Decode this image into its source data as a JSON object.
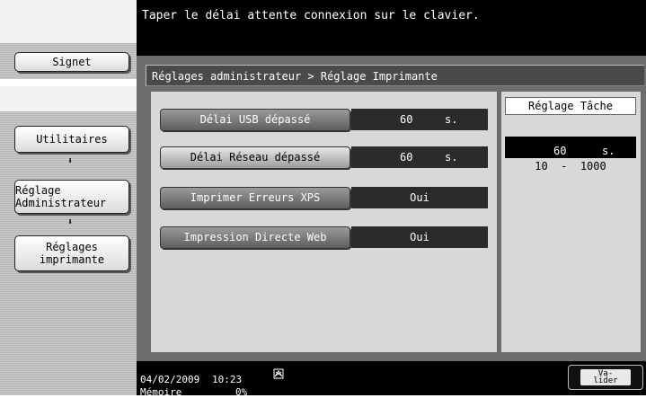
{
  "message": "Taper le délai attente connexion sur le clavier.",
  "sidebar": {
    "bookmark_label": "Signet",
    "utilities_label": "Utilitaires",
    "admin_label": "Réglage\nAdministrateur",
    "printer_label": "Réglages\nimprimante",
    "arrow_glyph": "⬇"
  },
  "breadcrumb": "Réglages administrateur  > Réglage Imprimante",
  "rows": [
    {
      "label": "Délai USB dépassé",
      "value": "60",
      "unit": "s."
    },
    {
      "label": "Délai Réseau dépassé",
      "value": "60",
      "unit": "s."
    },
    {
      "label": "Imprimer Erreurs XPS",
      "value": "Oui"
    },
    {
      "label": "Impression Directe Web",
      "value": "Oui"
    }
  ],
  "setting_panel": {
    "title": "Réglage Tâche",
    "current_value": "60",
    "unit": "s.",
    "range": "10  -  1000"
  },
  "status": {
    "date": "04/02/2009",
    "time": "10:23",
    "memory_label": "Mémoire",
    "memory_value": "0%"
  },
  "validate_label": "Va-\nlider"
}
